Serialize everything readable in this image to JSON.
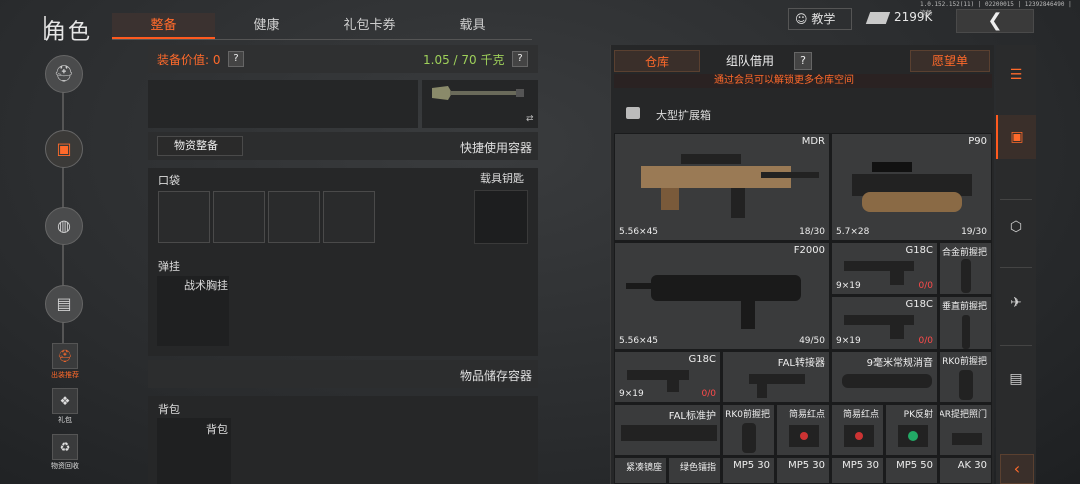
{
  "header": {
    "title": "角色",
    "tabs": [
      "整备",
      "健康",
      "礼包卡券",
      "载具"
    ],
    "teach_label": "教学",
    "currency": "2199K",
    "version": "1.0.152.152(11) | 02200015 | 12392846490 | 流畅"
  },
  "left_rail": {
    "icons": [
      "helmet-icon",
      "backpack-icon",
      "bag-icon",
      "crate-icon"
    ],
    "items": [
      {
        "label": "出装推荐"
      },
      {
        "label": "礼包"
      },
      {
        "label": "物资回收"
      }
    ]
  },
  "equip": {
    "value_label": "装备价值: 0",
    "help": "?",
    "weight": "1.05 / 70 千克",
    "material_button": "物资整备",
    "quick_container": "快捷使用容器",
    "pocket_label": "口袋",
    "vehicle_key_label": "载具钥匙",
    "vest_section_label": "弹挂",
    "vest_item": "战术胸挂",
    "storage_title": "物品储存容器",
    "bag_section_label": "背包",
    "bag_item": "背包"
  },
  "storage": {
    "tab_warehouse": "仓库",
    "tab_team": "组队借用",
    "help": "?",
    "wishlist": "愿望单",
    "notice": "通过会员可以解锁更多仓库空间",
    "container": "大型扩展箱",
    "items": [
      {
        "name": "MDR",
        "ammo": "5.56×45",
        "count": "18/30"
      },
      {
        "name": "P90",
        "ammo": "5.7×28",
        "count": "19/30"
      },
      {
        "name": "F2000",
        "ammo": "5.56×45",
        "count": "49/50"
      },
      {
        "name": "G18C",
        "ammo": "9×19",
        "count": "0/0"
      },
      {
        "name": "合金前握把"
      },
      {
        "name": "G18C",
        "ammo": "9×19",
        "count": "0/0"
      },
      {
        "name": "垂直前握把"
      },
      {
        "name": "G18C",
        "ammo": "9×19",
        "count": "0/0"
      },
      {
        "name": "FAL转接器"
      },
      {
        "name": "9毫米常规消音"
      },
      {
        "name": "RK0前握把"
      },
      {
        "name": "FAL标准护"
      },
      {
        "name": "RK0前握把"
      },
      {
        "name": "简易红点"
      },
      {
        "name": "简易红点"
      },
      {
        "name": "PK反射"
      },
      {
        "name": "AR提把照门"
      },
      {
        "name": "紧凑镜座"
      },
      {
        "name": "绿色镭指"
      },
      {
        "name": "MP5 30"
      },
      {
        "name": "MP5 30"
      },
      {
        "name": "MP5 30"
      },
      {
        "name": "MP5 50"
      },
      {
        "name": "AK 30"
      }
    ]
  },
  "right_rail": [
    "storage-icon",
    "cube-icon",
    "rifle-icon",
    "ammo-box-icon"
  ]
}
